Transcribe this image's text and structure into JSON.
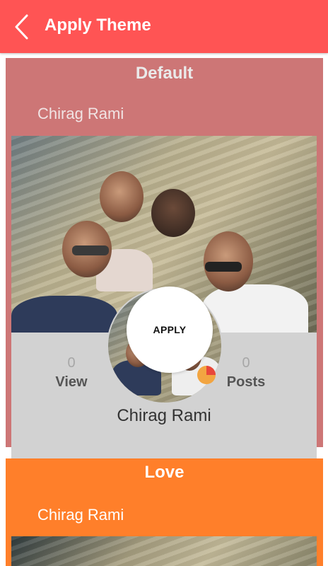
{
  "appbar": {
    "title": "Apply Theme",
    "back_icon": "chevron-left-icon",
    "background": "#ff5454"
  },
  "themes": [
    {
      "name": "Default",
      "user": "Chirag Rami",
      "card_color": "#cd7676",
      "stats": {
        "view_count": "0",
        "view_label": "View",
        "posts_count": "0",
        "posts_label": "Posts"
      },
      "profile_name": "Chirag Rami",
      "apply_label": "APPLY"
    },
    {
      "name": "Love",
      "user": "Chirag Rami",
      "card_color": "#ff7f2a"
    }
  ]
}
